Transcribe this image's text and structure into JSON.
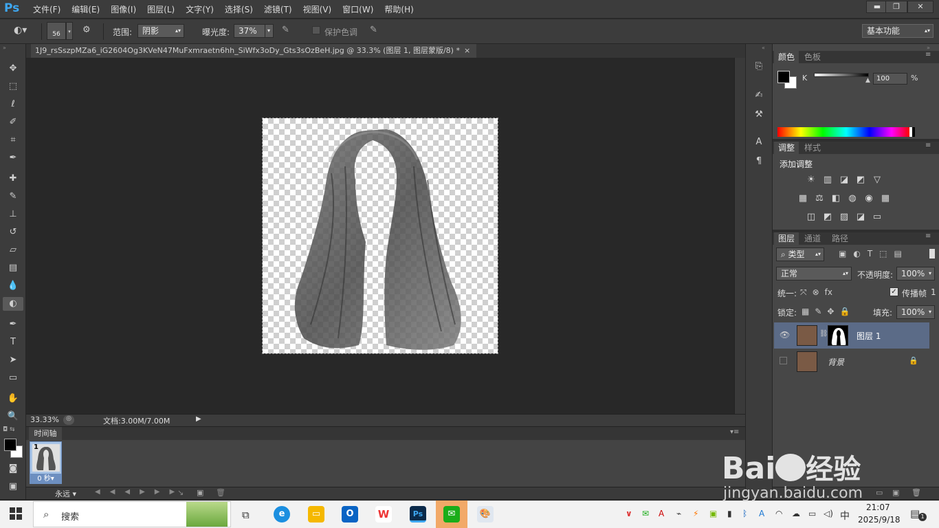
{
  "app": {
    "logo": "Ps",
    "menus": [
      "文件(F)",
      "编辑(E)",
      "图像(I)",
      "图层(L)",
      "文字(Y)",
      "选择(S)",
      "滤镜(T)",
      "视图(V)",
      "窗口(W)",
      "帮助(H)"
    ]
  },
  "window_controls": {
    "minimize": "▬",
    "restore": "❐",
    "close": "✕"
  },
  "options": {
    "brush_size": "56",
    "range_label": "范围:",
    "range_value": "阴影",
    "exposure_label": "曝光度:",
    "exposure_value": "37%",
    "protect_tones": "保护色调",
    "workspace": "基本功能"
  },
  "document": {
    "tab_title": "1J9_rsSszpMZa6_iG2604Og3KVeN47MuFxmraetn6hh_SiWfx3oDy_Gts3sOzBeH.jpg @ 33.3% (图层 1, 图层蒙版/8) *",
    "close": "×"
  },
  "status": {
    "zoom": "33.33%",
    "doc_size": "文档:3.00M/7.00M"
  },
  "timeline": {
    "tab": "时间轴",
    "frame_number": "1",
    "frame_time": "0 秒▾",
    "loop": "永远"
  },
  "color_panel": {
    "tabs": [
      "颜色",
      "色板"
    ],
    "channel": "K",
    "value": "100",
    "unit": "%"
  },
  "adjust_panel": {
    "tabs": [
      "调整",
      "样式"
    ],
    "title": "添加调整",
    "row1": [
      "☀",
      "▥",
      "◪",
      "◩",
      "▽"
    ],
    "row2": [
      "▦",
      "⚖",
      "◧",
      "◍",
      "◉",
      "▦"
    ],
    "row3": [
      "◫",
      "◩",
      "▨",
      "◪",
      "▭"
    ]
  },
  "layers_panel": {
    "tabs": [
      "图层",
      "通道",
      "路径"
    ],
    "filter": "类型",
    "blend_mode": "正常",
    "opacity_label": "不透明度:",
    "opacity_value": "100%",
    "unify_label": "统一:",
    "propagate_label": "传播帧",
    "propagate_value": "1",
    "lock_label": "锁定:",
    "fill_label": "填充:",
    "fill_value": "100%",
    "layers": [
      {
        "name": "图层 1"
      },
      {
        "name": "背景"
      }
    ]
  },
  "taskbar": {
    "search_placeholder": "搜索",
    "ime": "中",
    "time": "21:07",
    "date": "2025/9/18",
    "notification_count": "1"
  },
  "watermark": {
    "text": "jingyan.baidu.com",
    "brand": "Bai",
    "brand_suffix": "经验"
  }
}
